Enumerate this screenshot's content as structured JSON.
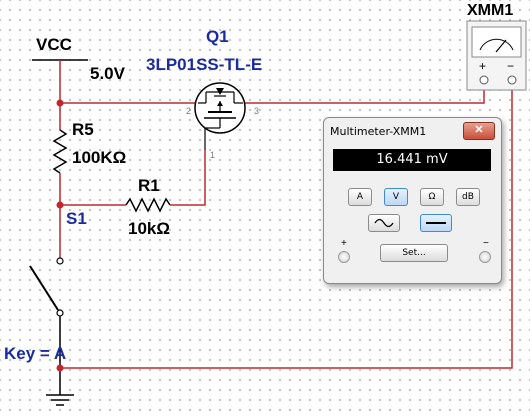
{
  "schematic": {
    "vcc_label": "VCC",
    "vcc_value": "5.0V",
    "transistor_ref": "Q1",
    "transistor_part": "3LP01SS-TL-E",
    "resistor_r5_ref": "R5",
    "resistor_r5_value": "100KΩ",
    "resistor_r1_ref": "R1",
    "resistor_r1_value": "10kΩ",
    "switch_ref": "S1",
    "switch_key": "Key = A",
    "meter_ref": "XMM1",
    "pin_2": "2",
    "pin_3": "3",
    "pin_1": "1",
    "meter_plus": "+",
    "meter_minus": "−"
  },
  "multimeter_window": {
    "title": "Multimeter-XMM1",
    "close_label": "✕",
    "reading": "16.441 mV",
    "buttons": [
      "A",
      "V",
      "Ω",
      "dB"
    ],
    "active_button": "V",
    "set_label": "Set...",
    "plus_label": "+",
    "minus_label": "−"
  },
  "colors": {
    "wire_red": "#c0282e",
    "wire_black": "#000000",
    "label_blue": "#1b2ca0",
    "active_border": "#3d8bd8"
  }
}
